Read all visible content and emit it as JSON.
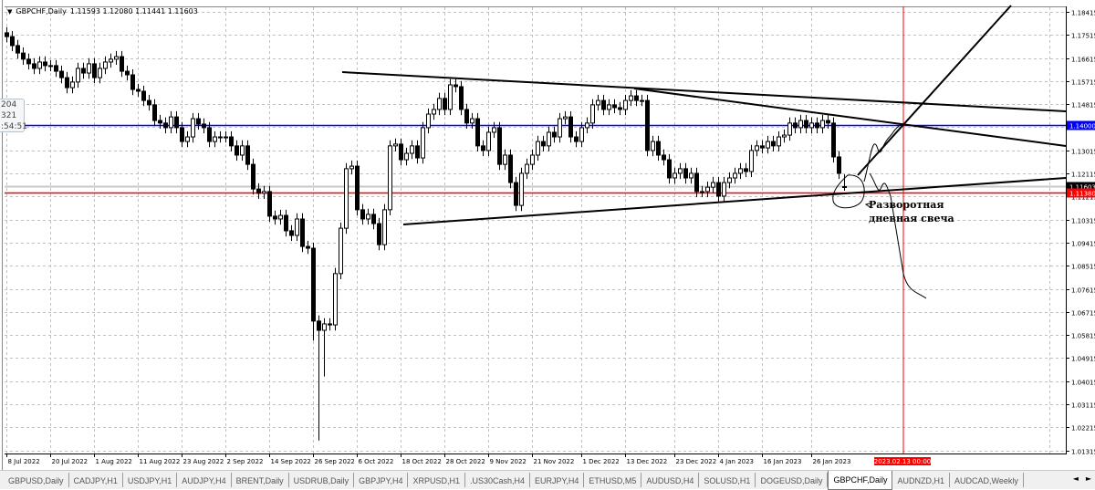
{
  "window": {
    "symbol_label": "GBPCHF,Daily",
    "ohlc": "1.11593 1.12080 1.11441 1.11603"
  },
  "tooltip": {
    "lines": [
      "204",
      "321",
      ":54:51"
    ]
  },
  "chart_data": {
    "type": "candlestick",
    "symbol": "GBPCHF",
    "timeframe": "Daily",
    "ylim": [
      1.01315,
      1.18415
    ],
    "price_ticks": [
      "1.18415",
      "1.17515",
      "1.16615",
      "1.15715",
      "1.14815",
      "1.13915",
      "1.13015",
      "1.12115",
      "1.11215",
      "1.10315",
      "1.09415",
      "1.08515",
      "1.07615",
      "1.06715",
      "1.05815",
      "1.04915",
      "1.04015",
      "1.03115",
      "1.02215",
      "1.01315"
    ],
    "first_open": 1.176,
    "closes": [
      1.1745,
      1.171,
      1.1681,
      1.1657,
      1.1639,
      1.1621,
      1.1646,
      1.1632,
      1.1632,
      1.161,
      1.1585,
      1.1546,
      1.1568,
      1.1621,
      1.1603,
      1.1639,
      1.1585,
      1.1621,
      1.1646,
      1.1657,
      1.1667,
      1.161,
      1.1596,
      1.1539,
      1.1532,
      1.1496,
      1.1479,
      1.1418,
      1.1408,
      1.139,
      1.1432,
      1.139,
      1.1336,
      1.1354,
      1.1425,
      1.1404,
      1.139,
      1.1336,
      1.1354,
      1.1354,
      1.1354,
      1.1319,
      1.1283,
      1.1319,
      1.1247,
      1.1151,
      1.1134,
      1.1141,
      1.1045,
      1.1034,
      1.1048,
      1.0988,
      1.097,
      1.1034,
      1.0927,
      1.092,
      1.0636,
      1.06,
      1.0625,
      1.0621,
      1.0821,
      1.0998,
      1.123,
      1.124,
      1.107,
      1.1034,
      1.1052,
      1.1016,
      1.0934,
      1.107,
      1.1319,
      1.1326,
      1.1265,
      1.129,
      1.1319,
      1.1272,
      1.139,
      1.1443,
      1.1461,
      1.1504,
      1.1461,
      1.1557,
      1.155,
      1.1461,
      1.1408,
      1.1425,
      1.1319,
      1.1301,
      1.1372,
      1.139,
      1.1247,
      1.1283,
      1.1176,
      1.1087,
      1.1212,
      1.1247,
      1.1283,
      1.1336,
      1.1319,
      1.1372,
      1.1354,
      1.1425,
      1.1432,
      1.1354,
      1.1336,
      1.139,
      1.1408,
      1.1479,
      1.1496,
      1.1461,
      1.1479,
      1.1468,
      1.1461,
      1.1496,
      1.1514,
      1.1496,
      1.1496,
      1.1301,
      1.1336,
      1.1283,
      1.1265,
      1.1194,
      1.1212,
      1.123,
      1.1194,
      1.1212,
      1.1141,
      1.1141,
      1.1158,
      1.1176,
      1.1123,
      1.1176,
      1.1194,
      1.1212,
      1.123,
      1.1219,
      1.1301,
      1.1319,
      1.1311,
      1.1336,
      1.1319,
      1.1354,
      1.1361,
      1.1408,
      1.139,
      1.1418,
      1.139,
      1.1408,
      1.139,
      1.1418,
      1.1408,
      1.1276,
      1.1212,
      1.116
    ],
    "last_candle": {
      "open": 1.11593,
      "high": 1.1208,
      "low": 1.11441,
      "close": 1.11603
    },
    "low_overrides": {
      "57": 1.017,
      "58": 1.042,
      "56": 1.056
    },
    "date_ticks": [
      {
        "label": "8 Jul 2022",
        "bar": 0
      },
      {
        "label": "20 Jul 2022",
        "bar": 8
      },
      {
        "label": "1 Aug 2022",
        "bar": 16
      },
      {
        "label": "11 Aug 2022",
        "bar": 24
      },
      {
        "label": "23 Aug 2022",
        "bar": 32
      },
      {
        "label": "2 Sep 2022",
        "bar": 40
      },
      {
        "label": "14 Sep 2022",
        "bar": 48
      },
      {
        "label": "26 Sep 2022",
        "bar": 56
      },
      {
        "label": "6 Oct 2022",
        "bar": 64
      },
      {
        "label": "18 Oct 2022",
        "bar": 72
      },
      {
        "label": "28 Oct 2022",
        "bar": 80
      },
      {
        "label": "9 Nov 2022",
        "bar": 88
      },
      {
        "label": "21 Nov 2022",
        "bar": 96
      },
      {
        "label": "1 Dec 2022",
        "bar": 105
      },
      {
        "label": "13 Dec 2022",
        "bar": 113
      },
      {
        "label": "23 Dec 2022",
        "bar": 122
      },
      {
        "label": "4 Jan 2023",
        "bar": 130
      },
      {
        "label": "16 Jan 2023",
        "bar": 138
      },
      {
        "label": "26 Jan 2023",
        "bar": 147
      }
    ],
    "hlines": [
      {
        "price": 1.14,
        "label": "1.14000",
        "color": "#0000ff"
      },
      {
        "price": 1.1138,
        "label": "1.11380",
        "color": "#ff0000"
      }
    ],
    "current_price": {
      "price": 1.11603,
      "label": "1.11603"
    },
    "vline": {
      "label": "2023.02.13 00:00",
      "color": "#ff0000"
    },
    "annotation": [
      "Разворотная",
      "дневная свеча"
    ]
  },
  "tabs": [
    {
      "label": "GBPUSD,Daily"
    },
    {
      "label": "CADJPY,H1"
    },
    {
      "label": "USDJPY,H1"
    },
    {
      "label": "AUDJPY,H4"
    },
    {
      "label": "BRENT,Daily"
    },
    {
      "label": "USDRUB,Daily"
    },
    {
      "label": "GBPJPY,H4"
    },
    {
      "label": "XRPUSD,H1"
    },
    {
      "label": ".US30Cash,H4"
    },
    {
      "label": "EURJPY,H4"
    },
    {
      "label": "ETHUSD,M5"
    },
    {
      "label": "AUDUSD,H4"
    },
    {
      "label": "SOLUSD,H1"
    },
    {
      "label": "DOGEUSD,Daily"
    },
    {
      "label": "GBPCHF,Daily",
      "active": true
    },
    {
      "label": "AUDNZD,H1"
    },
    {
      "label": "AUDCAD,Weekly"
    }
  ],
  "tab_scroll": {
    "left": "◄",
    "right": "►"
  }
}
